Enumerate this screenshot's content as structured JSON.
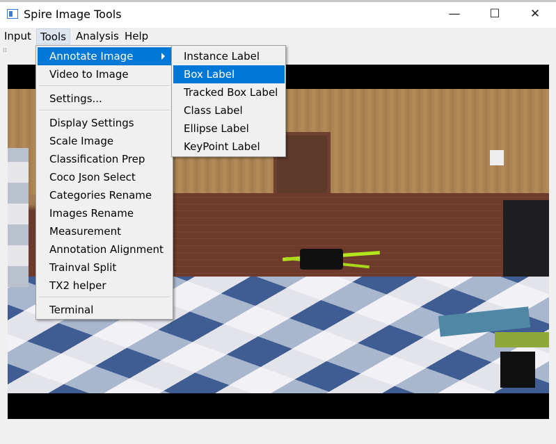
{
  "window": {
    "title": "Spire Image Tools",
    "controls": {
      "minimize": "—",
      "maximize": "☐",
      "close": "✕"
    }
  },
  "menubar": {
    "items": [
      {
        "label": "Input"
      },
      {
        "label": "Tools",
        "active": true
      },
      {
        "label": "Analysis"
      },
      {
        "label": "Help"
      }
    ]
  },
  "tools_menu": {
    "items": [
      {
        "label": "Annotate Image",
        "highlighted": true,
        "has_submenu": true
      },
      {
        "label": "Video to Image"
      },
      {
        "label": "Settings..."
      },
      {
        "label": "Display Settings"
      },
      {
        "label": "Scale Image"
      },
      {
        "label": "Classification Prep"
      },
      {
        "label": "Coco Json Select"
      },
      {
        "label": "Categories Rename"
      },
      {
        "label": "Images Rename"
      },
      {
        "label": "Measurement"
      },
      {
        "label": "Annotation Alignment"
      },
      {
        "label": "Trainval Split"
      },
      {
        "label": "TX2 helper"
      },
      {
        "label": "Terminal"
      }
    ]
  },
  "annotate_submenu": {
    "items": [
      {
        "label": "Instance Label"
      },
      {
        "label": "Box Label",
        "highlighted": true
      },
      {
        "label": "Tracked Box Label"
      },
      {
        "label": "Class Label"
      },
      {
        "label": "Ellipse Label"
      },
      {
        "label": "KeyPoint Label"
      }
    ]
  },
  "colors": {
    "highlight": "#0078d7",
    "menu_bg": "#f0f0f0",
    "active_menubar": "#dde6f0"
  }
}
